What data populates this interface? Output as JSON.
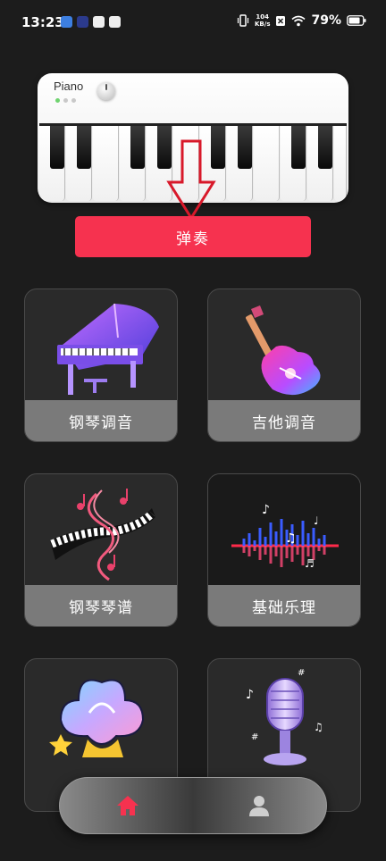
{
  "status_bar": {
    "time": "13:23",
    "net_speed_value": "104",
    "net_speed_unit": "KB/s",
    "battery": "79%"
  },
  "piano_preview": {
    "brand": "Piano"
  },
  "play_button": {
    "label": "弹奏"
  },
  "features": [
    {
      "label": "钢琴调音",
      "icon": "grand-piano-icon"
    },
    {
      "label": "吉他调音",
      "icon": "electric-guitar-icon"
    },
    {
      "label": "钢琴琴谱",
      "icon": "sheet-music-keys-icon"
    },
    {
      "label": "基础乐理",
      "icon": "sound-wave-icon"
    },
    {
      "label": "",
      "icon": "music-flower-icon"
    },
    {
      "label": "",
      "icon": "microphone-icon"
    }
  ],
  "bottom_nav": {
    "items": [
      {
        "name": "home",
        "icon": "home-icon",
        "active": true
      },
      {
        "name": "profile",
        "icon": "user-icon",
        "active": false
      }
    ]
  },
  "colors": {
    "background": "#1c1c1c",
    "accent": "#f6324f",
    "card_label_bg": "#7a7a7a"
  }
}
